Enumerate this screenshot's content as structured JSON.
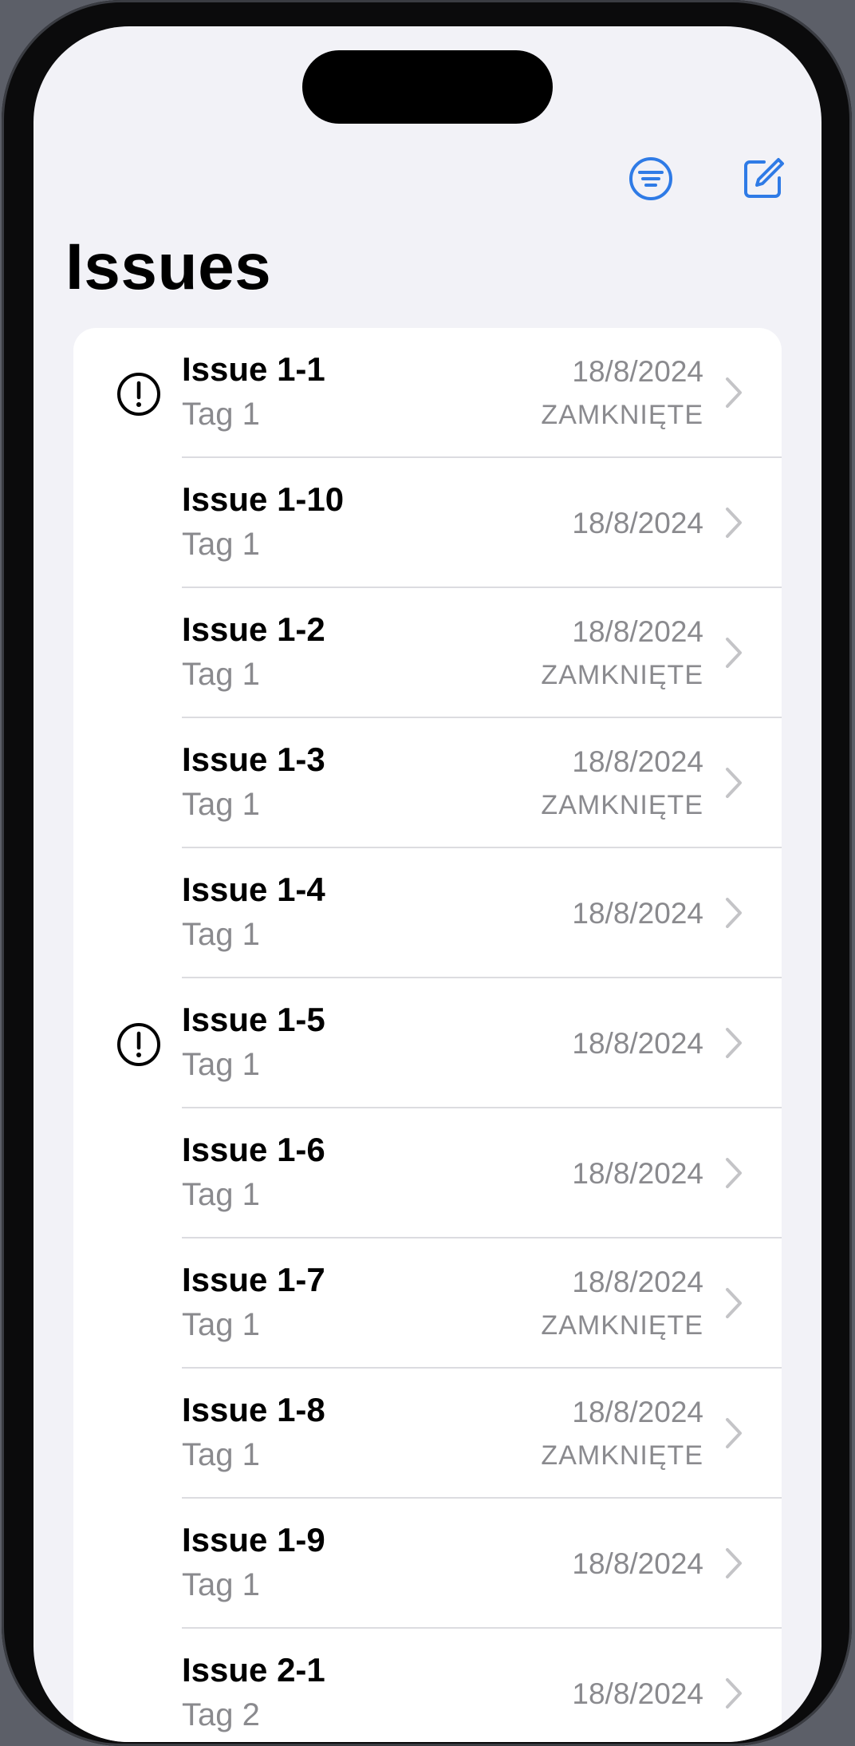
{
  "nav": {
    "title": "Issues",
    "accent_color": "#2f7be6"
  },
  "issues": [
    {
      "title": "Issue 1-1",
      "tag": "Tag 1",
      "date": "18/8/2024",
      "status": "ZAMKNIĘTE",
      "alert": true
    },
    {
      "title": "Issue 1-10",
      "tag": "Tag 1",
      "date": "18/8/2024",
      "status": "",
      "alert": false
    },
    {
      "title": "Issue 1-2",
      "tag": "Tag 1",
      "date": "18/8/2024",
      "status": "ZAMKNIĘTE",
      "alert": false
    },
    {
      "title": "Issue 1-3",
      "tag": "Tag 1",
      "date": "18/8/2024",
      "status": "ZAMKNIĘTE",
      "alert": false
    },
    {
      "title": "Issue 1-4",
      "tag": "Tag 1",
      "date": "18/8/2024",
      "status": "",
      "alert": false
    },
    {
      "title": "Issue 1-5",
      "tag": "Tag 1",
      "date": "18/8/2024",
      "status": "",
      "alert": true
    },
    {
      "title": "Issue 1-6",
      "tag": "Tag 1",
      "date": "18/8/2024",
      "status": "",
      "alert": false
    },
    {
      "title": "Issue 1-7",
      "tag": "Tag 1",
      "date": "18/8/2024",
      "status": "ZAMKNIĘTE",
      "alert": false
    },
    {
      "title": "Issue 1-8",
      "tag": "Tag 1",
      "date": "18/8/2024",
      "status": "ZAMKNIĘTE",
      "alert": false
    },
    {
      "title": "Issue 1-9",
      "tag": "Tag 1",
      "date": "18/8/2024",
      "status": "",
      "alert": false
    },
    {
      "title": "Issue 2-1",
      "tag": "Tag 2",
      "date": "18/8/2024",
      "status": "",
      "alert": false
    }
  ],
  "icons": {
    "filter": "filter-circle-icon",
    "compose": "compose-icon",
    "alert": "exclamation-circle-icon",
    "disclosure": "chevron-right-icon"
  }
}
